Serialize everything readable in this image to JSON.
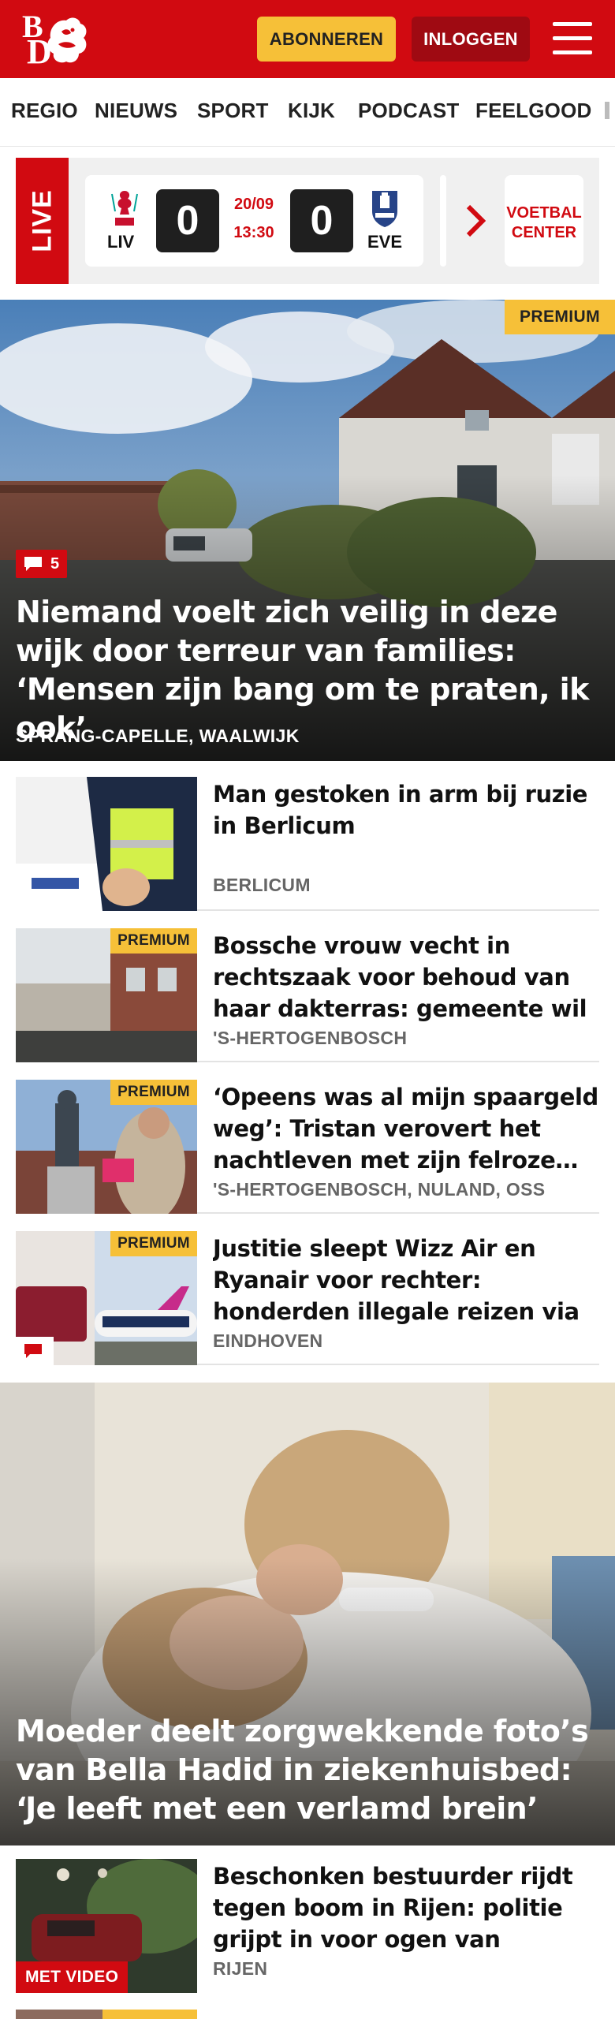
{
  "header": {
    "logo_top": "B",
    "logo_bottom": "D",
    "subscribe_label": "ABONNEREN",
    "login_label": "INLOGGEN",
    "colors": {
      "brand_red": "#d10a11",
      "premium_yellow": "#f6c038",
      "login_dark_red": "#9f0a12"
    }
  },
  "nav": {
    "items": [
      "REGIO",
      "NIEUWS",
      "SPORT",
      "KIJK",
      "PODCAST",
      "FEELGOOD"
    ]
  },
  "live": {
    "badge": "LIVE",
    "match": {
      "home_code": "LIV",
      "away_code": "EVE",
      "home_score": "0",
      "away_score": "0",
      "date": "20/09",
      "time": "13:30"
    },
    "voetbal_center": [
      "VOETBAL",
      "CENTER"
    ]
  },
  "hero1": {
    "premium": "PREMIUM",
    "comments": "5",
    "title": "Niemand voelt zich veilig in deze wijk door terreur van families: ‘Mensen zijn bang om te praten, ik ook’",
    "location": "SPRANG-CAPELLE, WAALWIJK"
  },
  "list1": [
    {
      "title": "Man gestoken in arm bij ruzie in Berlicum",
      "location": "BERLICUM"
    },
    {
      "premium": "PREMIUM",
      "title": "Bossche vrouw vecht in rechtszaak voor behoud van haar dakterras: gemeente wil ze niet…",
      "location": "'S-HERTOGENBOSCH"
    },
    {
      "premium": "PREMIUM",
      "title": "‘Opeens was al mijn spaargeld weg’: Tristan verovert het nachtleven met zijn felroze…",
      "location": "'S-HERTOGENBOSCH, NULAND, OSS"
    },
    {
      "premium": "PREMIUM",
      "title": "Justitie sleept Wizz Air en Ryanair voor rechter: honderden illegale reizen via Eindhoven…",
      "location": "EINDHOVEN"
    }
  ],
  "hero2": {
    "title": "Moeder deelt zorgwekkende foto’s van Bella Hadid in ziekenhuisbed: ‘Je leeft met een verlamd brein’"
  },
  "list2": [
    {
      "video": "MET VIDEO",
      "title": "Beschonken bestuurder rijdt tegen boom in Rijen: politie grijpt in voor ogen van feestgangers",
      "location": "RIJEN"
    }
  ]
}
